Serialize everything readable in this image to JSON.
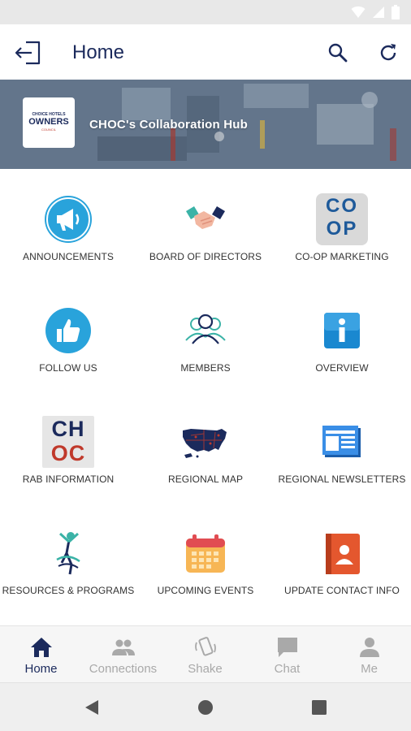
{
  "app_bar": {
    "title": "Home"
  },
  "banner": {
    "title": "CHOC's Collaboration Hub",
    "logo_lines": [
      "CHOICE HOTELS",
      "OWNERS",
      "COUNCIL"
    ]
  },
  "grid": {
    "tiles": [
      {
        "label": "ANNOUNCEMENTS",
        "icon": "megaphone-icon"
      },
      {
        "label": "BOARD OF DIRECTORS",
        "icon": "handshake-icon"
      },
      {
        "label": "CO-OP MARKETING",
        "icon": "coop-logo-icon"
      },
      {
        "label": "FOLLOW US",
        "icon": "thumbs-up-icon"
      },
      {
        "label": "MEMBERS",
        "icon": "members-icon"
      },
      {
        "label": "OVERVIEW",
        "icon": "info-icon"
      },
      {
        "label": "RAB INFORMATION",
        "icon": "choc-logo-icon"
      },
      {
        "label": "REGIONAL MAP",
        "icon": "usa-map-icon"
      },
      {
        "label": "REGIONAL NEWSLETTERS",
        "icon": "newsletter-icon"
      },
      {
        "label": "RESOURCES & PROGRAMS",
        "icon": "yoga-figure-icon"
      },
      {
        "label": "UPCOMING EVENTS",
        "icon": "calendar-icon"
      },
      {
        "label": "UPDATE CONTACT INFO",
        "icon": "contact-book-icon"
      }
    ]
  },
  "icon_text": {
    "coop_top": "CO",
    "coop_bottom": "OP",
    "choc_top": "CH",
    "choc_bottom": "OC"
  },
  "bottom_nav": {
    "items": [
      {
        "label": "Home",
        "icon": "home-icon",
        "active": true
      },
      {
        "label": "Connections",
        "icon": "people-icon",
        "active": false
      },
      {
        "label": "Shake",
        "icon": "shake-phone-icon",
        "active": false
      },
      {
        "label": "Chat",
        "icon": "chat-icon",
        "active": false
      },
      {
        "label": "Me",
        "icon": "person-icon",
        "active": false
      }
    ]
  },
  "colors": {
    "primary": "#1b2a5c",
    "inactive": "#a9a9a9",
    "icon_blue": "#29a3db",
    "accent_red": "#c0392b",
    "calendar_orange": "#f7b655",
    "contact_orange": "#e4572e"
  }
}
